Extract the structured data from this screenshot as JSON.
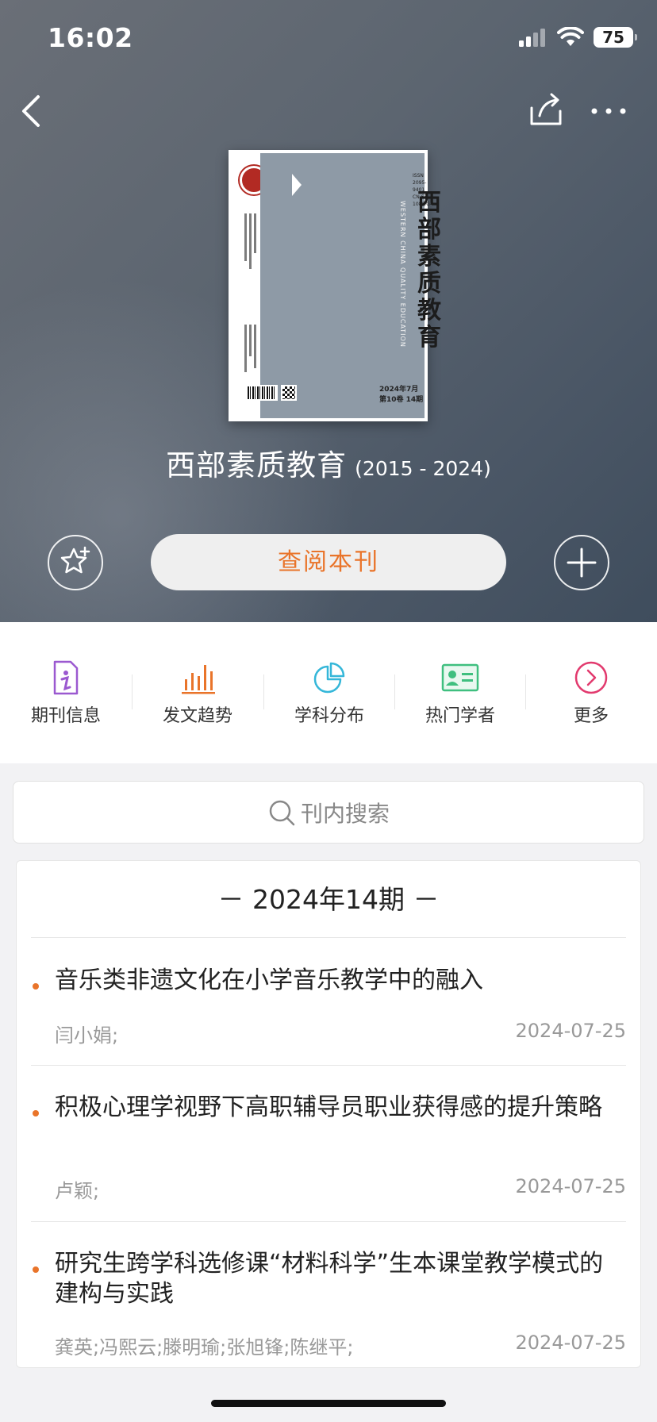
{
  "status_bar": {
    "time": "16:02",
    "battery": "75"
  },
  "journal": {
    "name": "西部素质教育",
    "years": "(2015 - 2024)",
    "cover_title_chars": [
      "西",
      "部",
      "素",
      "质",
      "教",
      "育"
    ],
    "cover_en": "WESTERN CHINA QUALITY EDUCATION",
    "cover_issn": "ISSN 2095-9401",
    "cover_cn": "CN 63-1080/G4",
    "cover_issue": "2024年7月 第10卷 14期"
  },
  "actions": {
    "read_label": "查阅本刊"
  },
  "quick_menu": [
    {
      "label": "期刊信息",
      "icon": "info-icon",
      "color": "#9b59d0"
    },
    {
      "label": "发文趋势",
      "icon": "bar-chart-icon",
      "color": "#e9742a"
    },
    {
      "label": "学科分布",
      "icon": "pie-chart-icon",
      "color": "#35b7d9"
    },
    {
      "label": "热门学者",
      "icon": "id-card-icon",
      "color": "#3fbf7f"
    },
    {
      "label": "更多",
      "icon": "more-arrow-icon",
      "color": "#e23a6e"
    }
  ],
  "search": {
    "placeholder": "刊内搜索"
  },
  "issue": {
    "heading": "－ 2024年14期 －"
  },
  "articles": [
    {
      "title": "音乐类非遗文化在小学音乐教学中的融入",
      "authors": "闫小娟;",
      "date": "2024-07-25"
    },
    {
      "title": "积极心理学视野下高职辅导员职业获得感的提升策略",
      "authors": "卢颖;",
      "date": "2024-07-25"
    },
    {
      "title": "研究生跨学科选修课“材料科学”生本课堂教学模式的建构与实践",
      "authors": "龚英;冯熙云;滕明瑜;张旭锋;陈继平;",
      "date": "2024-07-25"
    }
  ]
}
